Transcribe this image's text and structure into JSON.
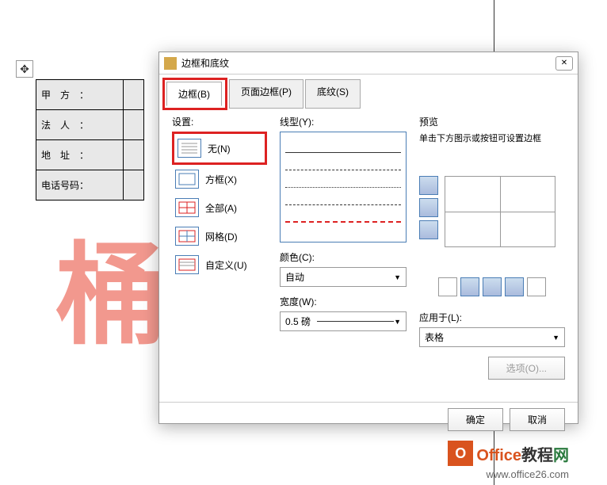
{
  "table": {
    "rows": [
      "甲　方　：",
      "法　人　：",
      "地　址　：",
      "电话号码："
    ]
  },
  "dialog": {
    "title": "边框和底纹",
    "tabs": [
      {
        "label": "边框(B)",
        "active": true,
        "highlighted": true
      },
      {
        "label": "页面边框(P)",
        "active": false,
        "highlighted": false
      },
      {
        "label": "底纹(S)",
        "active": false,
        "highlighted": false
      }
    ],
    "settings": {
      "label": "设置:",
      "items": [
        {
          "label": "无(N)",
          "highlighted": true
        },
        {
          "label": "方框(X)",
          "highlighted": false
        },
        {
          "label": "全部(A)",
          "highlighted": false
        },
        {
          "label": "网格(D)",
          "highlighted": false
        },
        {
          "label": "自定义(U)",
          "highlighted": false
        }
      ]
    },
    "style": {
      "label": "线型(Y):",
      "color_label": "颜色(C):",
      "color_value": "自动",
      "width_label": "宽度(W):",
      "width_value": "0.5 磅"
    },
    "preview": {
      "label": "预览",
      "hint": "单击下方图示或按钮可设置边框"
    },
    "apply": {
      "label": "应用于(L):",
      "value": "表格"
    },
    "options_btn": "选项(O)...",
    "ok": "确定",
    "cancel": "取消"
  },
  "watermark": {
    "text1": "桶",
    "text2": "O"
  },
  "footer": {
    "brand": "Office教程网",
    "url": "www.office26.com"
  }
}
